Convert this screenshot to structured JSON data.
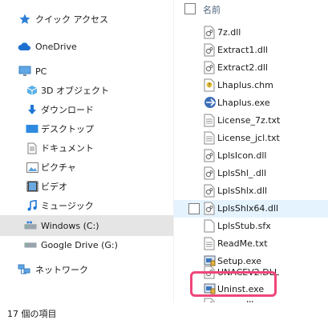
{
  "nav": {
    "items": [
      {
        "label": "クイック アクセス",
        "icon": "star-icon"
      },
      {
        "label": "OneDrive",
        "icon": "cloud-icon"
      },
      {
        "label": "PC",
        "icon": "monitor-icon"
      },
      {
        "label": "3D オブジェクト",
        "icon": "cube-icon"
      },
      {
        "label": "ダウンロード",
        "icon": "download-icon"
      },
      {
        "label": "デスクトップ",
        "icon": "desktop-icon"
      },
      {
        "label": "ドキュメント",
        "icon": "document-icon"
      },
      {
        "label": "ピクチャ",
        "icon": "picture-icon"
      },
      {
        "label": "ビデオ",
        "icon": "video-icon"
      },
      {
        "label": "ミュージック",
        "icon": "music-icon"
      },
      {
        "label": "Windows (C:)",
        "icon": "windows-drive-icon"
      },
      {
        "label": "Google Drive (G:)",
        "icon": "drive-icon"
      },
      {
        "label": "ネットワーク",
        "icon": "network-icon"
      }
    ],
    "selected": "Windows (C:)"
  },
  "list": {
    "column_name": "名前",
    "files": [
      {
        "name": "7z.dll",
        "icon": "dll-file-icon"
      },
      {
        "name": "Extract1.dll",
        "icon": "dll-file-icon"
      },
      {
        "name": "Extract2.dll",
        "icon": "dll-file-icon"
      },
      {
        "name": "Lhaplus.chm",
        "icon": "help-file-icon"
      },
      {
        "name": "Lhaplus.exe",
        "icon": "lhaplus-app-icon"
      },
      {
        "name": "License_7z.txt",
        "icon": "text-file-icon"
      },
      {
        "name": "License_jcl.txt",
        "icon": "text-file-icon"
      },
      {
        "name": "LplsIcon.dll",
        "icon": "dll-file-icon"
      },
      {
        "name": "LplsShl_.dll",
        "icon": "dll-file-icon"
      },
      {
        "name": "LplsShlx.dll",
        "icon": "dll-file-icon"
      },
      {
        "name": "LplsShlx64.dll",
        "icon": "dll-file-icon"
      },
      {
        "name": "LplsStub.sfx",
        "icon": "generic-file-icon"
      },
      {
        "name": "ReadMe.txt",
        "icon": "text-file-icon"
      },
      {
        "name": "Setup.exe",
        "icon": "installer-icon"
      },
      {
        "name": "UNACEV2.DLL",
        "icon": "dll-file-icon"
      },
      {
        "name": "Uninst.exe",
        "icon": "installer-icon"
      },
      {
        "name": "unrar.dll",
        "icon": "dll-file-icon"
      }
    ],
    "hover_file": "LplsShlx64.dll",
    "highlighted_file": "Uninst.exe",
    "highlight_color": "#f0457a"
  },
  "status": {
    "item_count": "17 個の項目"
  }
}
